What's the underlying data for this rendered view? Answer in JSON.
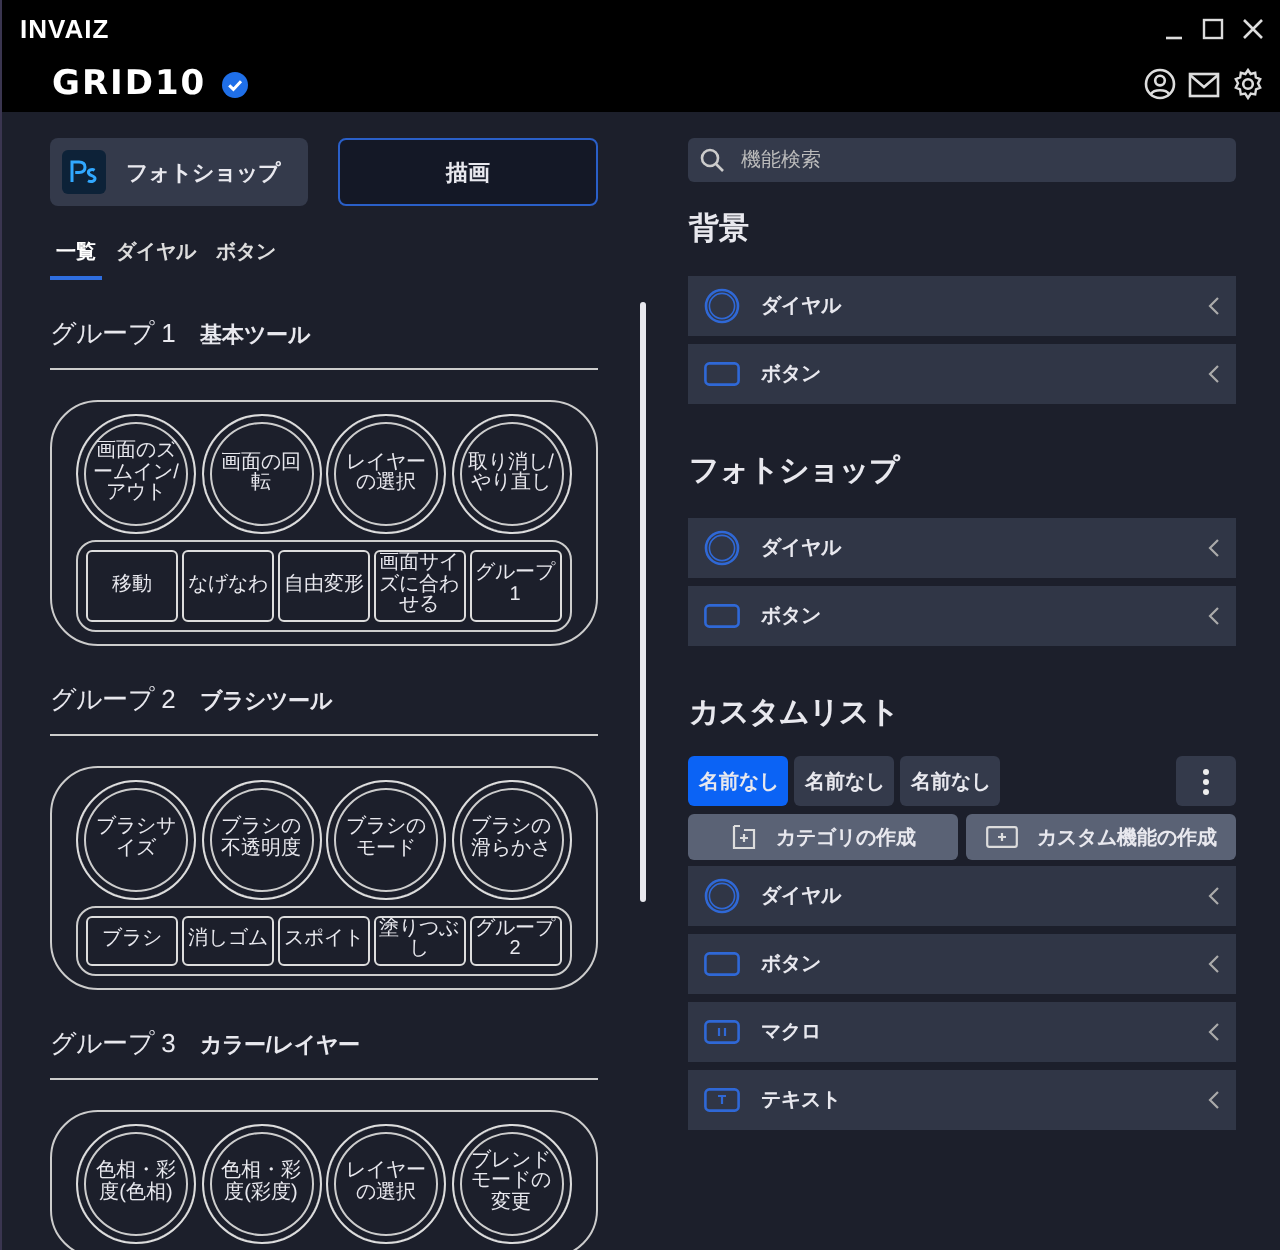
{
  "header": {
    "brand": "INVAIZ",
    "device": "GRID10"
  },
  "left": {
    "app_button": {
      "label": "フォトショップ"
    },
    "mode_button": {
      "label": "描画"
    },
    "tabs": [
      {
        "label": "一覧",
        "selected": true
      },
      {
        "label": "ダイヤル",
        "selected": false
      },
      {
        "label": "ボタン",
        "selected": false
      }
    ],
    "groups": [
      {
        "title": "グループ 1",
        "subtitle": "基本ツール",
        "dials": [
          "画面のズームイン/アウト",
          "画面の回転",
          "レイヤーの選択",
          "取り消し/やり直し"
        ],
        "buttons": [
          "移動",
          "なげなわ",
          "自由変形",
          "画面サイズに合わせる",
          "グループ1"
        ]
      },
      {
        "title": "グループ 2",
        "subtitle": "ブラシツール",
        "dials": [
          "ブラシサイズ",
          "ブラシの不透明度",
          "ブラシのモード",
          "ブラシの滑らかさ"
        ],
        "buttons": [
          "ブラシ",
          "消しゴム",
          "スポイト",
          "塗りつぶし",
          "グループ2"
        ]
      },
      {
        "title": "グループ 3",
        "subtitle": "カラー/レイヤー",
        "dials": [
          "色相・彩度(色相)",
          "色相・彩度(彩度)",
          "レイヤーの選択",
          "ブレンドモードの変更"
        ]
      }
    ]
  },
  "right": {
    "search": {
      "placeholder": "機能検索"
    },
    "sections": [
      {
        "title": "背景",
        "rows": [
          {
            "kind": "dial",
            "label": "ダイヤル"
          },
          {
            "kind": "button",
            "label": "ボタン"
          }
        ]
      },
      {
        "title": "フォトショップ",
        "rows": [
          {
            "kind": "dial",
            "label": "ダイヤル"
          },
          {
            "kind": "button",
            "label": "ボタン"
          }
        ]
      }
    ],
    "custom": {
      "title": "カスタムリスト",
      "tabs": [
        {
          "label": "名前なし",
          "selected": true
        },
        {
          "label": "名前なし",
          "selected": false
        },
        {
          "label": "名前なし",
          "selected": false
        }
      ],
      "actions": [
        {
          "kind": "category",
          "label": "カテゴリの作成"
        },
        {
          "kind": "function",
          "label": "カスタム機能の作成"
        }
      ],
      "rows": [
        {
          "kind": "dial",
          "label": "ダイヤル"
        },
        {
          "kind": "button",
          "label": "ボタン"
        },
        {
          "kind": "macro",
          "label": "マクロ"
        },
        {
          "kind": "text",
          "label": "テキスト"
        }
      ]
    }
  }
}
